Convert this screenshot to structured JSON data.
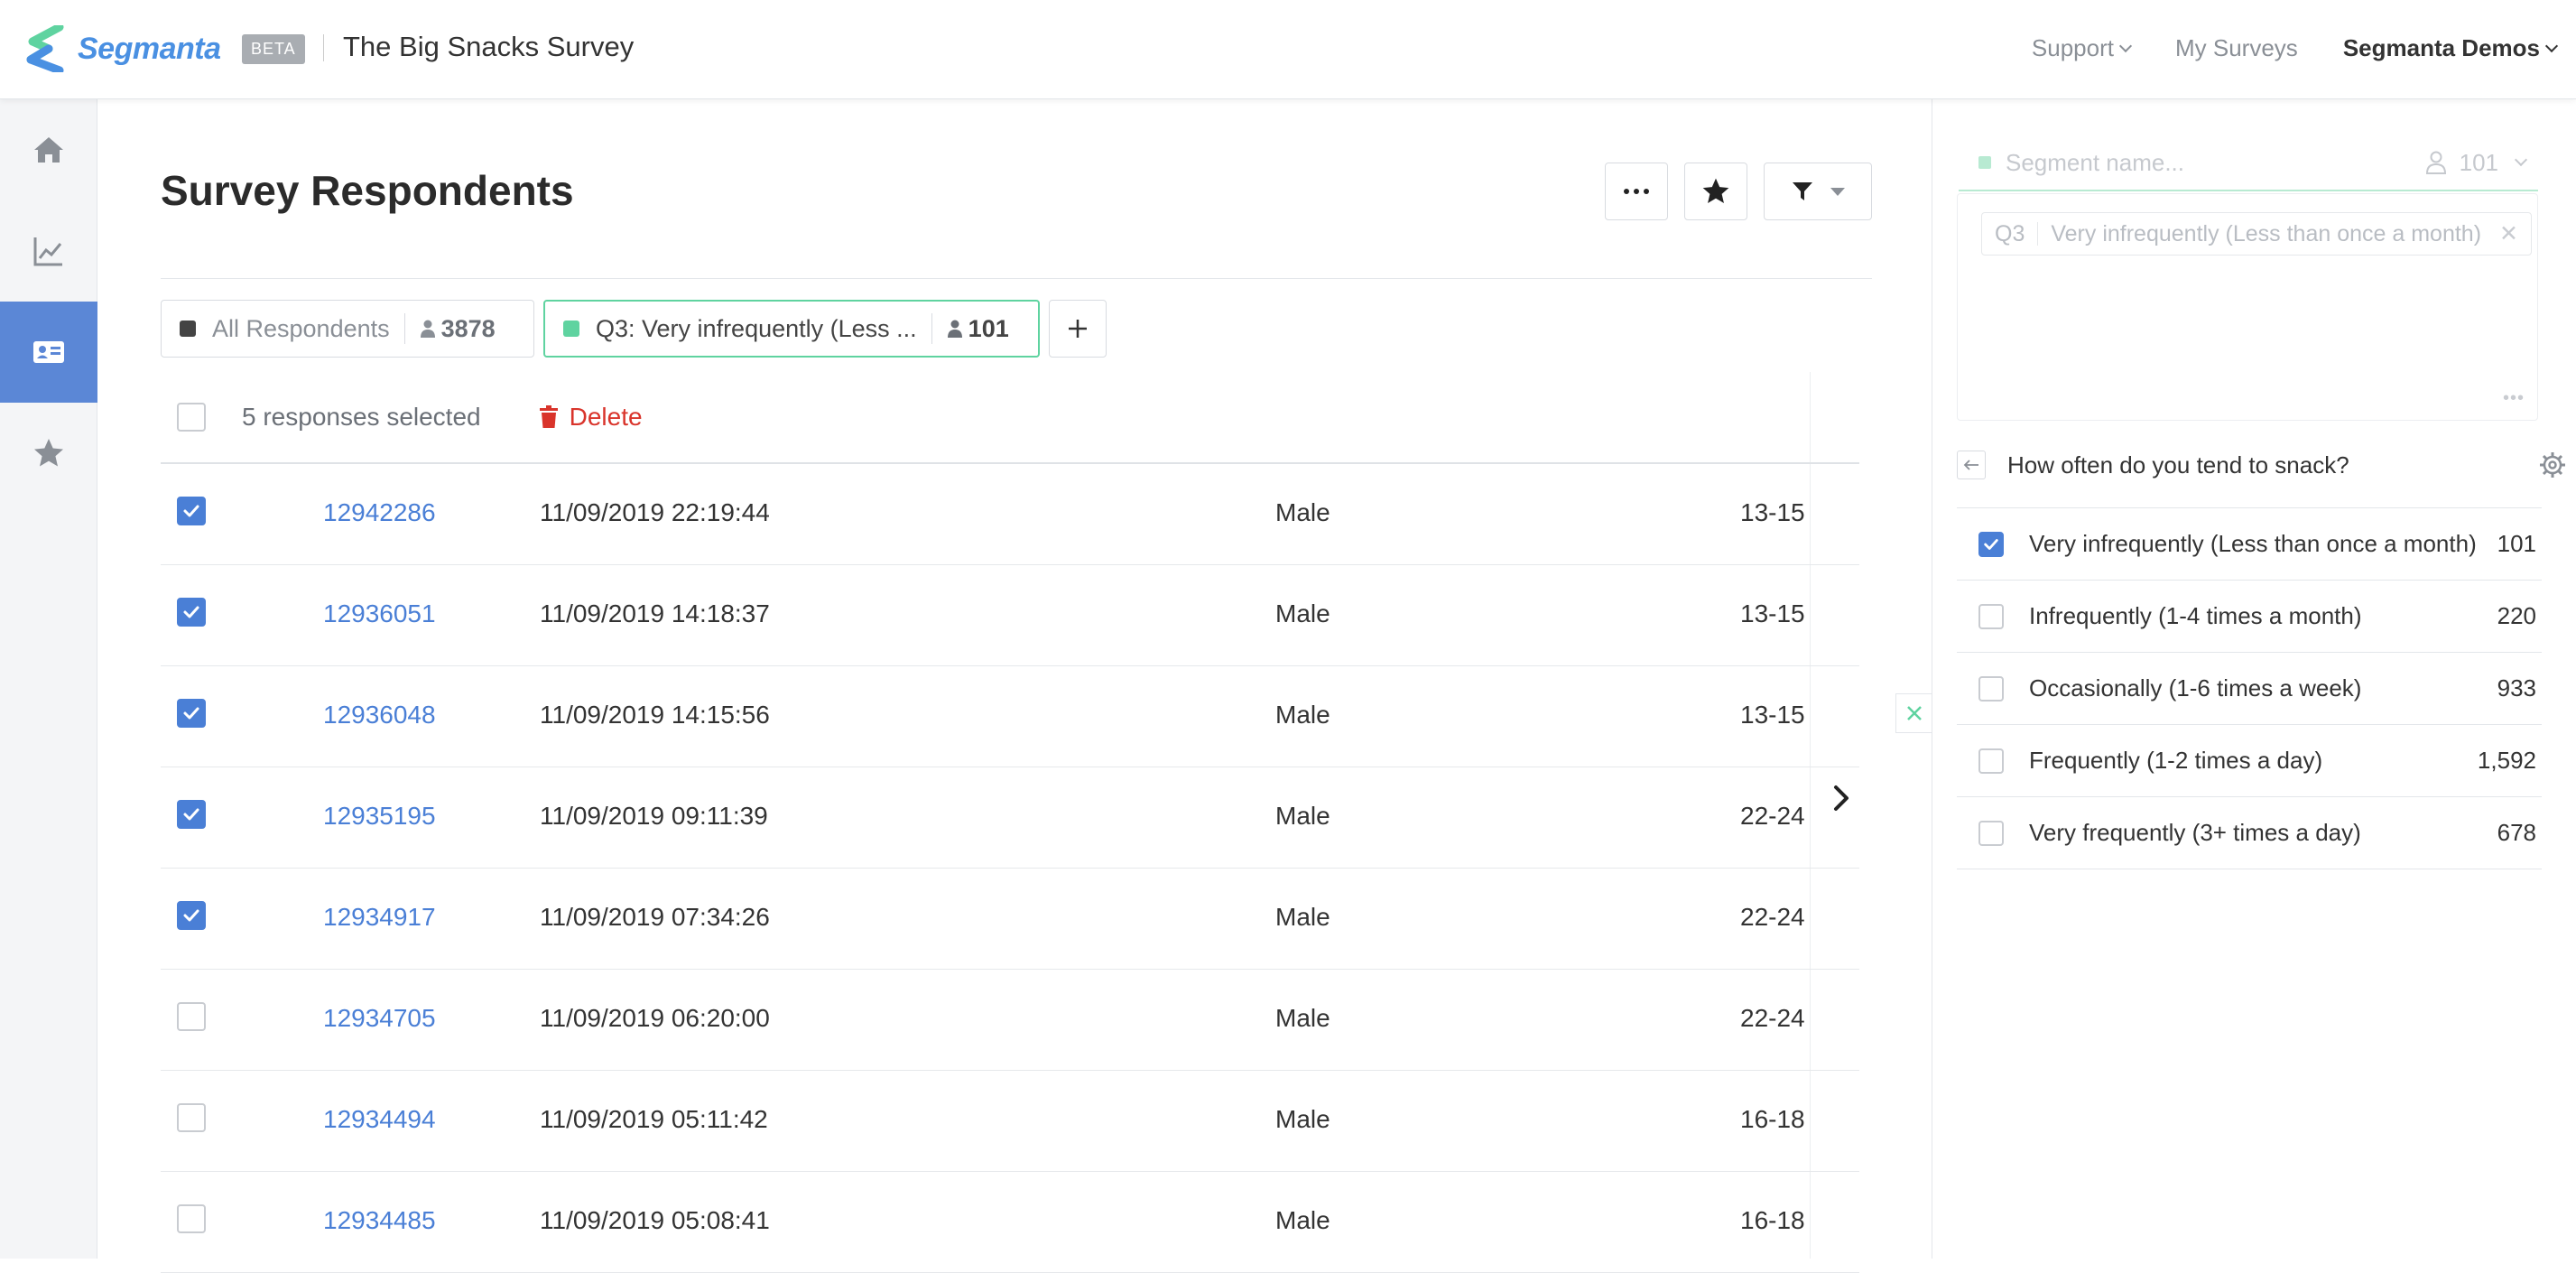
{
  "app": {
    "logo_text": "Segmanta",
    "beta_label": "BETA",
    "survey_title": "The Big Snacks Survey"
  },
  "nav": {
    "support": "Support",
    "my_surveys": "My Surveys",
    "account": "Segmanta Demos"
  },
  "sidebar": {
    "items": [
      {
        "name": "home",
        "icon": "home-icon",
        "active": false
      },
      {
        "name": "analytics",
        "icon": "chart-icon",
        "active": false
      },
      {
        "name": "respondents",
        "icon": "id-card-icon",
        "active": true
      },
      {
        "name": "favorites",
        "icon": "star-icon",
        "active": false
      }
    ]
  },
  "main": {
    "title": "Survey Respondents",
    "segments": [
      {
        "label": "All Respondents",
        "count": "3878",
        "color": "#444444"
      },
      {
        "label": "Q3: Very infrequently (Less ...",
        "count": "101",
        "color": "#5fd3a0"
      }
    ],
    "selection_text": "5 responses selected",
    "delete_label": "Delete",
    "rows": [
      {
        "id": "12942286",
        "date": "11/09/2019 22:19:44",
        "gender": "Male",
        "age": "13-15",
        "checked": true
      },
      {
        "id": "12936051",
        "date": "11/09/2019 14:18:37",
        "gender": "Male",
        "age": "13-15",
        "checked": true
      },
      {
        "id": "12936048",
        "date": "11/09/2019 14:15:56",
        "gender": "Male",
        "age": "13-15",
        "checked": true
      },
      {
        "id": "12935195",
        "date": "11/09/2019 09:11:39",
        "gender": "Male",
        "age": "22-24",
        "checked": true
      },
      {
        "id": "12934917",
        "date": "11/09/2019 07:34:26",
        "gender": "Male",
        "age": "22-24",
        "checked": true
      },
      {
        "id": "12934705",
        "date": "11/09/2019 06:20:00",
        "gender": "Male",
        "age": "22-24",
        "checked": false
      },
      {
        "id": "12934494",
        "date": "11/09/2019 05:11:42",
        "gender": "Male",
        "age": "16-18",
        "checked": false
      },
      {
        "id": "12934485",
        "date": "11/09/2019 05:08:41",
        "gender": "Male",
        "age": "16-18",
        "checked": false
      }
    ]
  },
  "panel": {
    "segment_name_placeholder": "Segment name...",
    "segment_count": "101",
    "filter_q": "Q3",
    "filter_text": "Very infrequently (Less than once a month)",
    "question": "How often do you tend to snack?",
    "options": [
      {
        "label": "Very infrequently (Less than once a month)",
        "count": "101",
        "checked": true
      },
      {
        "label": "Infrequently (1-4 times a month)",
        "count": "220",
        "checked": false
      },
      {
        "label": "Occasionally (1-6 times a week)",
        "count": "933",
        "checked": false
      },
      {
        "label": "Frequently (1-2 times a day)",
        "count": "1,592",
        "checked": false
      },
      {
        "label": "Very frequently (3+ times a day)",
        "count": "678",
        "checked": false
      }
    ]
  },
  "colors": {
    "accent_blue": "#4a7fd6",
    "segment_green": "#5fd3a0",
    "delete_red": "#d9342b"
  }
}
